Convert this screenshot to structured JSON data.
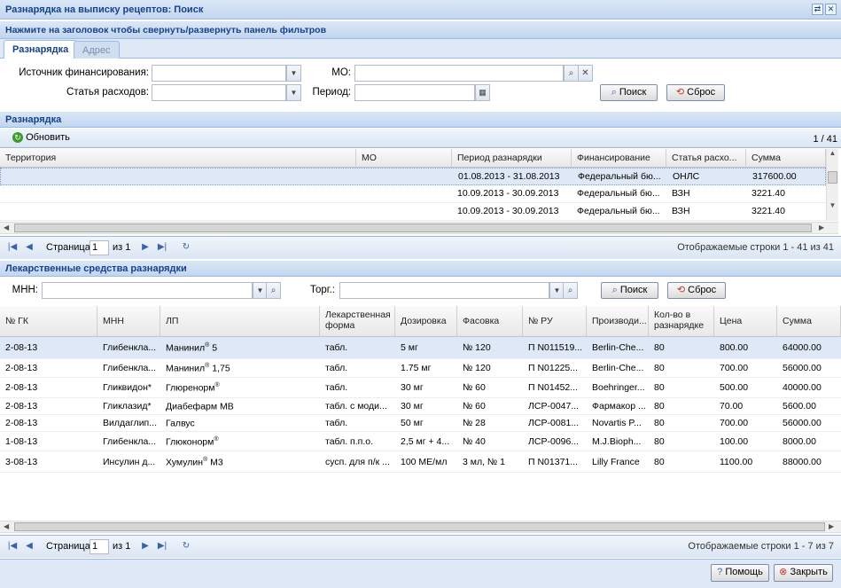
{
  "window": {
    "title": "Разнарядка на выписку рецептов: Поиск",
    "collapse_hint": "Нажмите на заголовок чтобы свернуть/развернуть панель фильтров"
  },
  "tabs": [
    {
      "label": "Разнарядка"
    },
    {
      "label": "Адрес"
    }
  ],
  "filters": {
    "funding_label": "Источник финансирования:",
    "expense_label": "Статья расходов:",
    "mo_label": "МО:",
    "period_label": "Период:",
    "search_label": "Поиск",
    "reset_label": "Сброс"
  },
  "allocation": {
    "title": "Разнарядка",
    "refresh_label": "Обновить",
    "count": "1 / 41",
    "columns": [
      "Территория",
      "МО",
      "Период разнарядки",
      "Финансирование",
      "Статья расхо...",
      "Сумма"
    ],
    "rows": [
      {
        "territory": "",
        "mo": "",
        "period": "01.08.2013 - 31.08.2013",
        "funding": "Федеральный бю...",
        "article": "ОНЛС",
        "sum": "317600.00"
      },
      {
        "territory": "",
        "mo": "",
        "period": "10.09.2013 - 30.09.2013",
        "funding": "Федеральный бю...",
        "article": "ВЗН",
        "sum": "3221.40"
      },
      {
        "territory": "",
        "mo": "",
        "period": "10.09.2013 - 30.09.2013",
        "funding": "Федеральный бю...",
        "article": "ВЗН",
        "sum": "3221.40"
      }
    ],
    "pager": {
      "page_label": "Страница",
      "page": "1",
      "of_label": "из 1",
      "status": "Отображаемые строки 1 - 41 из 41"
    }
  },
  "drugs": {
    "title": "Лекарственные средства разнарядки",
    "mnn_label": "МНН:",
    "torg_label": "Торг.:",
    "search_label": "Поиск",
    "reset_label": "Сброс",
    "columns": [
      "№ ГК",
      "МНН",
      "ЛП",
      "Лекарственная форма",
      "Дозировка",
      "Фасовка",
      "№ РУ",
      "Производи...",
      "Кол-во в разнарядке",
      "Цена",
      "Сумма"
    ],
    "rows": [
      {
        "gk": "2-08-13",
        "mnn": "Глибенкла...",
        "lp": "Манинил",
        "lp_sup": "®",
        "lp_suffix": " 5",
        "form": "табл.",
        "dose": "5 мг",
        "pack": "№ 120",
        "ru": "П N011519...",
        "maker": "Berlin-Che...",
        "qty": "80",
        "price": "800.00",
        "sum": "64000.00"
      },
      {
        "gk": "2-08-13",
        "mnn": "Глибенкла...",
        "lp": "Манинил",
        "lp_sup": "®",
        "lp_suffix": " 1,75",
        "form": "табл.",
        "dose": "1.75 мг",
        "pack": "№ 120",
        "ru": "П N01225...",
        "maker": "Berlin-Che...",
        "qty": "80",
        "price": "700.00",
        "sum": "56000.00"
      },
      {
        "gk": "2-08-13",
        "mnn": "Гликвидон*",
        "lp": "Глюренорм",
        "lp_sup": "®",
        "lp_suffix": "",
        "form": "табл.",
        "dose": "30 мг",
        "pack": "№ 60",
        "ru": "П N01452...",
        "maker": "Boehringer...",
        "qty": "80",
        "price": "500.00",
        "sum": "40000.00"
      },
      {
        "gk": "2-08-13",
        "mnn": "Гликлазид*",
        "lp": "Диабефарм МВ",
        "lp_sup": "",
        "lp_suffix": "",
        "form": "табл. с моди...",
        "dose": "30 мг",
        "pack": "№ 60",
        "ru": "ЛСР-0047...",
        "maker": "Фармакор ...",
        "qty": "80",
        "price": "70.00",
        "sum": "5600.00"
      },
      {
        "gk": "2-08-13",
        "mnn": "Вилдаглип...",
        "lp": "Галвус",
        "lp_sup": "",
        "lp_suffix": "",
        "form": "табл.",
        "dose": "50 мг",
        "pack": "№ 28",
        "ru": "ЛСР-0081...",
        "maker": "Novartis P...",
        "qty": "80",
        "price": "700.00",
        "sum": "56000.00"
      },
      {
        "gk": "1-08-13",
        "mnn": "Глибенкла...",
        "lp": "Глюконорм",
        "lp_sup": "®",
        "lp_suffix": "",
        "form": "табл. п.п.о.",
        "dose": "2,5 мг + 4...",
        "pack": "№ 40",
        "ru": "ЛСР-0096...",
        "maker": "M.J.Bioph...",
        "qty": "80",
        "price": "100.00",
        "sum": "8000.00"
      },
      {
        "gk": "3-08-13",
        "mnn": "Инсулин д...",
        "lp": "Хумулин",
        "lp_sup": "®",
        "lp_suffix": " М3",
        "form": "сусп. для п/к ...",
        "dose": "100 МЕ/мл",
        "pack": "3 мл, № 1",
        "ru": "П N01371...",
        "maker": "Lilly France",
        "qty": "80",
        "price": "1100.00",
        "sum": "88000.00"
      }
    ],
    "pager": {
      "page_label": "Страница",
      "page": "1",
      "of_label": "из 1",
      "status": "Отображаемые строки 1 - 7 из 7"
    }
  },
  "footer": {
    "help_label": "Помощь",
    "close_label": "Закрыть"
  },
  "colors": {
    "header_text": "#15428b",
    "selected_row": "#dfe8f6",
    "border": "#99bbe8"
  }
}
